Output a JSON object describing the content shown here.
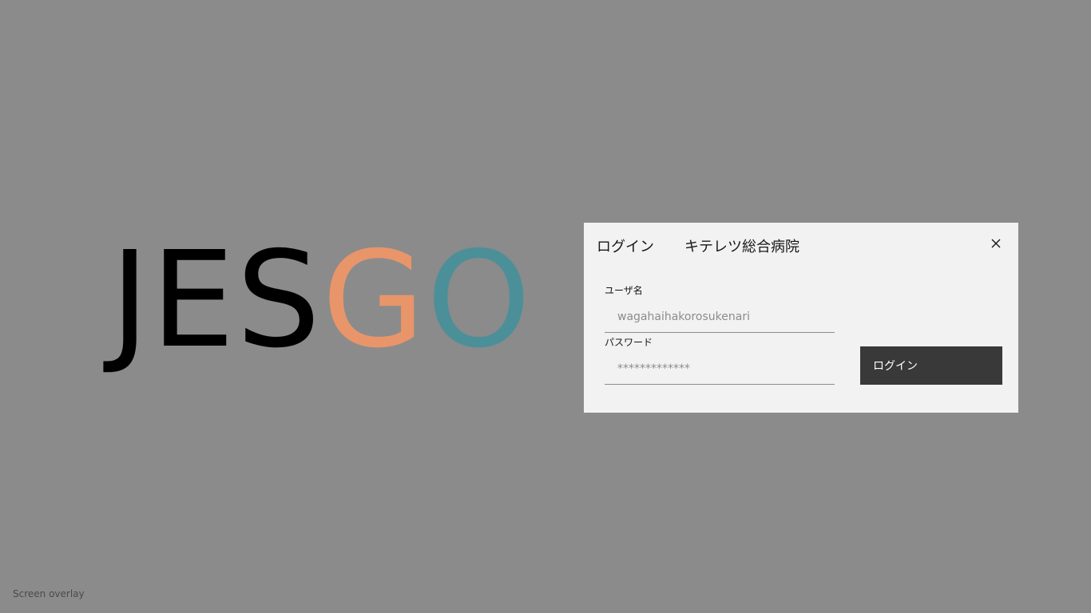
{
  "logo": {
    "letters_dark": "JES",
    "letter_orange": "G",
    "letter_teal": "O",
    "colors": {
      "dark": "#000000",
      "orange": "#e9956a",
      "teal": "#4b8f98"
    }
  },
  "dialog": {
    "title": "ログイン",
    "hospital_name": "キテレツ総合病院",
    "close_icon": "close-icon",
    "username": {
      "label": "ユーザ名",
      "value": "wagahaihakorosukenari"
    },
    "password": {
      "label": "パスワード",
      "value": "*************"
    },
    "submit_label": "ログイン",
    "colors": {
      "background": "#f2f2f2",
      "button": "#393939"
    }
  },
  "overlay": {
    "label": "Screen overlay",
    "color": "#8b8b8b"
  }
}
